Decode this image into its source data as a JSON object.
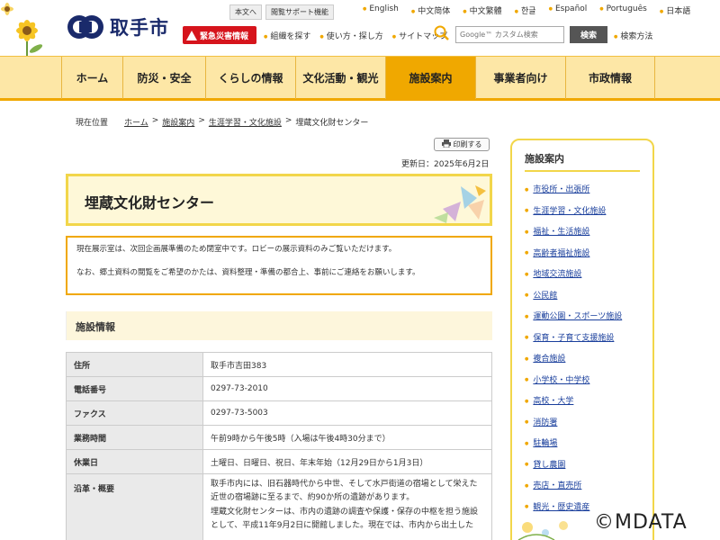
{
  "header": {
    "city_name": "取手市",
    "top_buttons": [
      "本文へ",
      "閲覧サポート機能"
    ],
    "languages": [
      "English",
      "中文简体",
      "中文繁體",
      "한글",
      "Español",
      "Português",
      "日本語"
    ],
    "emergency_label": "緊急災害情報",
    "tools": [
      "組織を探す",
      "使い方・探し方",
      "サイトマップ"
    ],
    "search_placeholder": "Google™ カスタム検索",
    "search_button": "検索",
    "search_howto": "検索方法"
  },
  "nav": {
    "items": [
      {
        "label": "ホーム",
        "width": 68
      },
      {
        "label": "防災・安全",
        "width": 92
      },
      {
        "label": "くらしの情報",
        "width": 100
      },
      {
        "label": "文化活動・観光",
        "width": 100
      },
      {
        "label": "施設案内",
        "width": 100
      },
      {
        "label": "事業者向け",
        "width": 100
      },
      {
        "label": "市政情報",
        "width": 100
      }
    ],
    "active_index": 4
  },
  "breadcrumb": {
    "label": "現在位置",
    "links": [
      "ホーム",
      "施設案内",
      "生涯学習・文化施設"
    ],
    "current": "埋蔵文化財センター"
  },
  "print_label": "印刷する",
  "updated": "更新日：2025年6月2日",
  "page_title": "埋蔵文化財センター",
  "notice": {
    "line1": "現在展示室は、次回企画展準備のため閉室中です。ロビーの展示資料のみご覧いただけます。",
    "line2": "なお、郷土資料の閲覧をご希望のかたは、資料整理・準備の都合上、事前にご連絡をお願いします。"
  },
  "facility_section_title": "施設情報",
  "facility_table": [
    {
      "label": "住所",
      "value": "取手市吉田383"
    },
    {
      "label": "電話番号",
      "value": "0297-73-2010"
    },
    {
      "label": "ファクス",
      "value": "0297-73-5003"
    },
    {
      "label": "業務時間",
      "value": "午前9時から午後5時（入場は午後4時30分まで）"
    },
    {
      "label": "休業日",
      "value": "土曜日、日曜日、祝日、年末年始（12月29日から1月3日）"
    }
  ],
  "history": {
    "label": "沿革・概要",
    "p1": "取手市内には、旧石器時代から中世、そして水戸街道の宿場として栄えた近世の宿場跡に至るまで、約90か所の遺跡があります。",
    "p2": "埋蔵文化財センターは、市内の遺跡の調査や保護・保存の中枢を担う施設として、平成11年9月2日に開館しました。現在では、市内から出土した"
  },
  "sidebar": {
    "title": "施設案内",
    "items": [
      "市役所・出張所",
      "生涯学習・文化施設",
      "福祉・生活施設",
      "高齢者福祉施設",
      "地域交流施設",
      "公民館",
      "運動公園・スポーツ施設",
      "保育・子育て支援施設",
      "複合施設",
      "小学校・中学校",
      "高校・大学",
      "消防署",
      "駐輪場",
      "貸し農園",
      "売店・直売所",
      "観光・歴史遺産"
    ]
  },
  "watermark": "©MDATA",
  "colors": {
    "accent": "#f0a800",
    "nav_bg": "#fde7a6",
    "emergency": "#d6141c",
    "link": "#1a3f9c"
  }
}
